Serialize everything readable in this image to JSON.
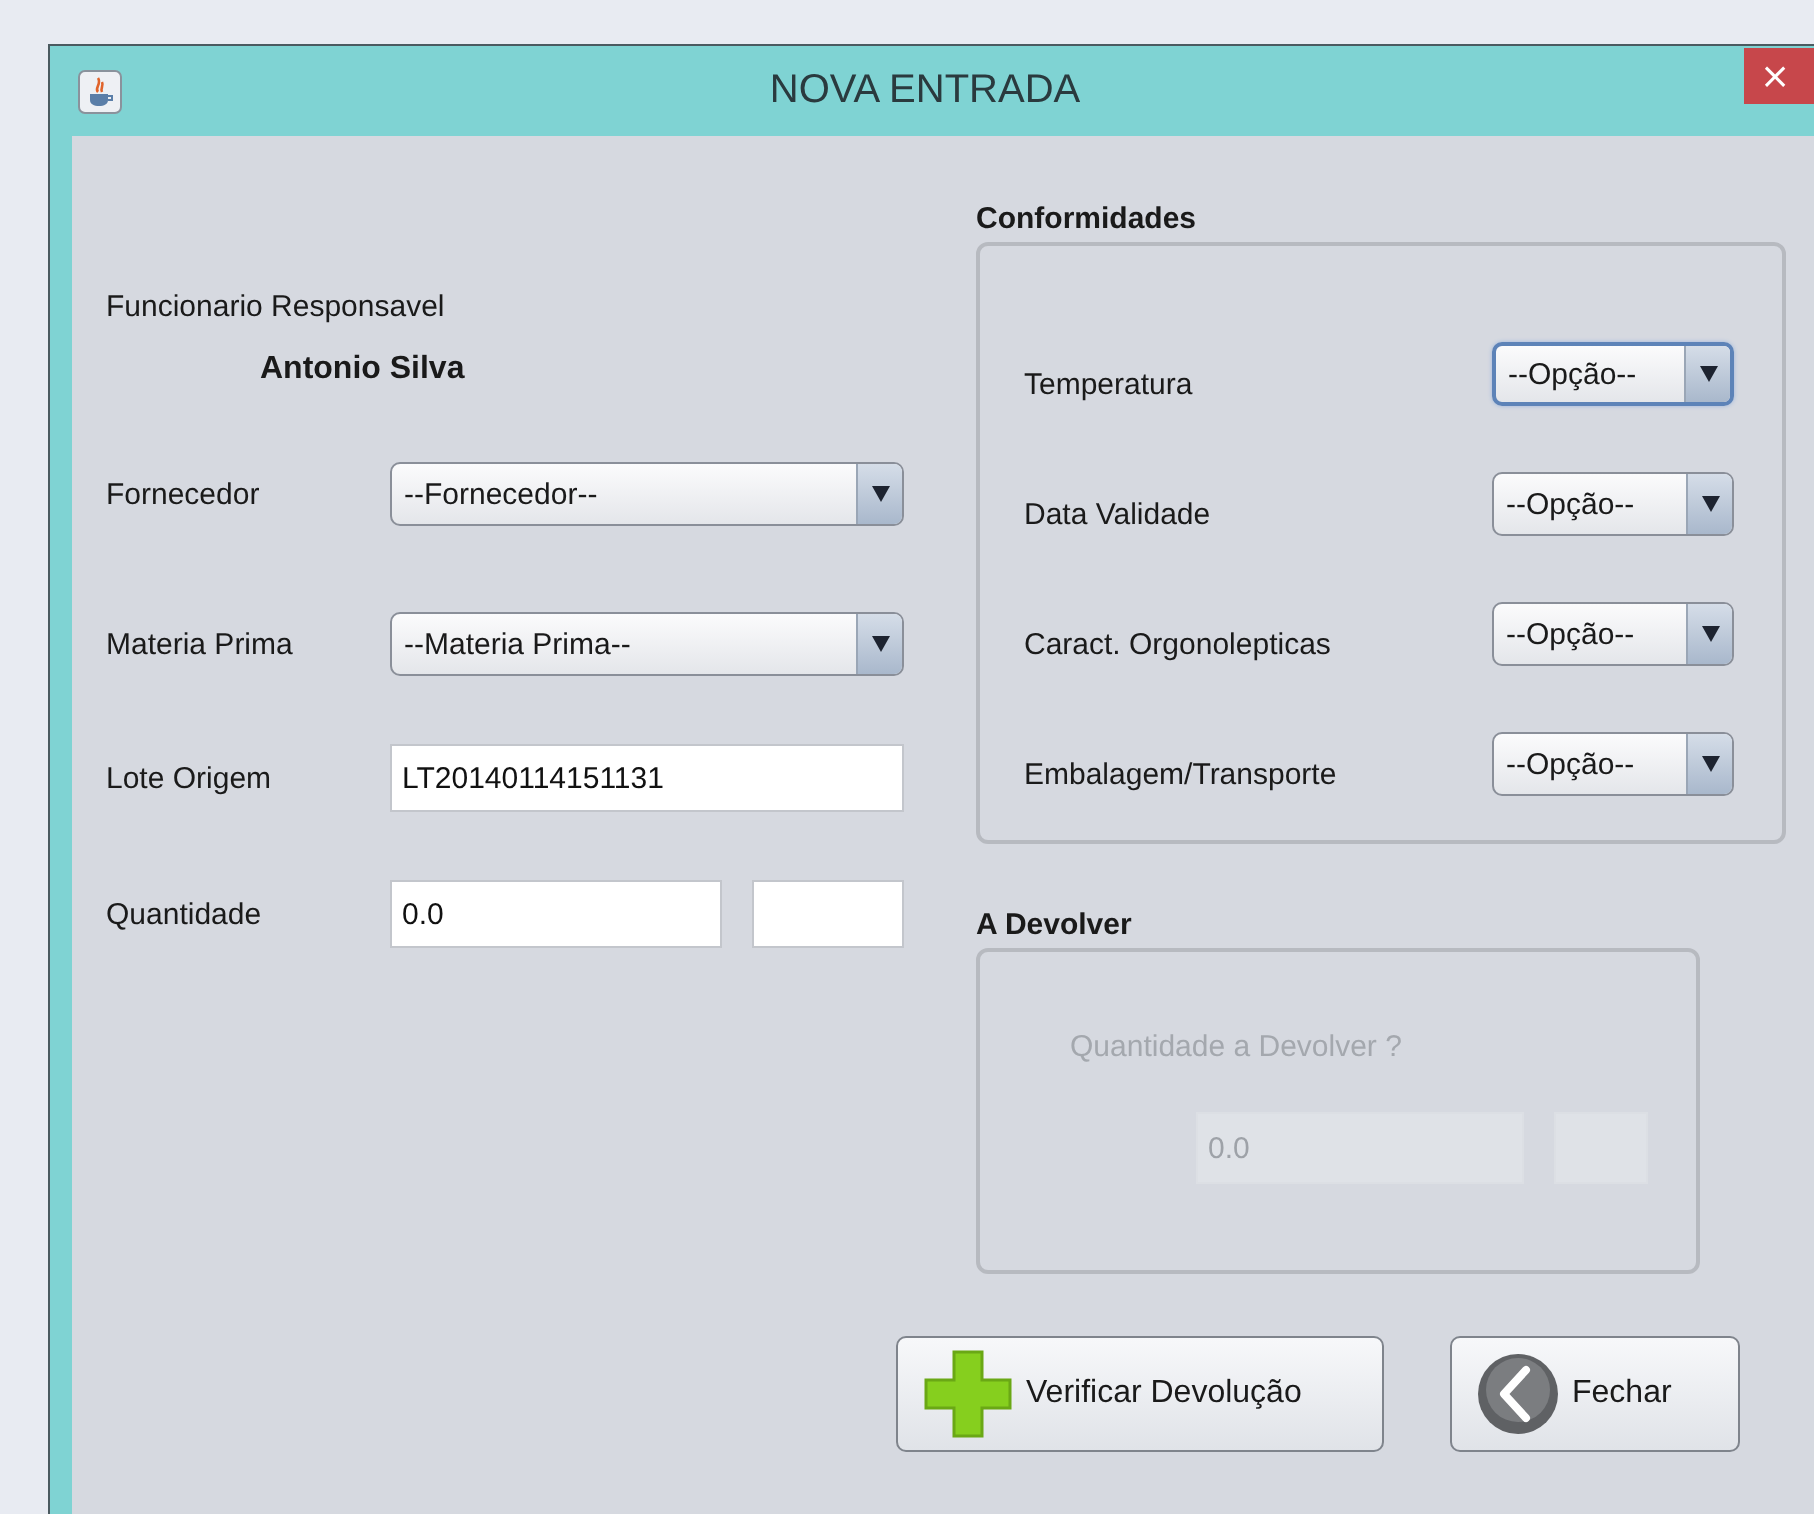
{
  "window": {
    "title": "NOVA ENTRADA",
    "close": "×"
  },
  "responsible": {
    "label": "Funcionario Responsavel",
    "name": "Antonio Silva"
  },
  "fields": [
    {
      "kind": "combo",
      "label": "Fornecedor",
      "value": "--Fornecedor--"
    },
    {
      "kind": "combo",
      "label": "Materia Prima",
      "value": "--Materia Prima--"
    },
    {
      "kind": "text",
      "label": "Lote Origem",
      "value": "LT20140114151131"
    },
    {
      "kind": "pair",
      "label": "Quantidade",
      "value": "0.0"
    }
  ],
  "conformidades": {
    "title": "Conformidades",
    "items": [
      {
        "label": "Temperatura",
        "value": "--Opção--",
        "focused": true
      },
      {
        "label": "Data Validade",
        "value": "--Opção--",
        "focused": false
      },
      {
        "label": "Caract. Orgonolepticas",
        "value": "--Opção--",
        "focused": false
      },
      {
        "label": "Embalagem/Transporte",
        "value": "--Opção--",
        "focused": false
      }
    ]
  },
  "devolver": {
    "title": "A Devolver",
    "disabled": true,
    "question": "Quantidade a Devolver ?",
    "value": "0.0"
  },
  "buttons": [
    {
      "kind": "add",
      "label": "Verificar Devolução"
    },
    {
      "kind": "back",
      "label": "Fechar"
    }
  ]
}
